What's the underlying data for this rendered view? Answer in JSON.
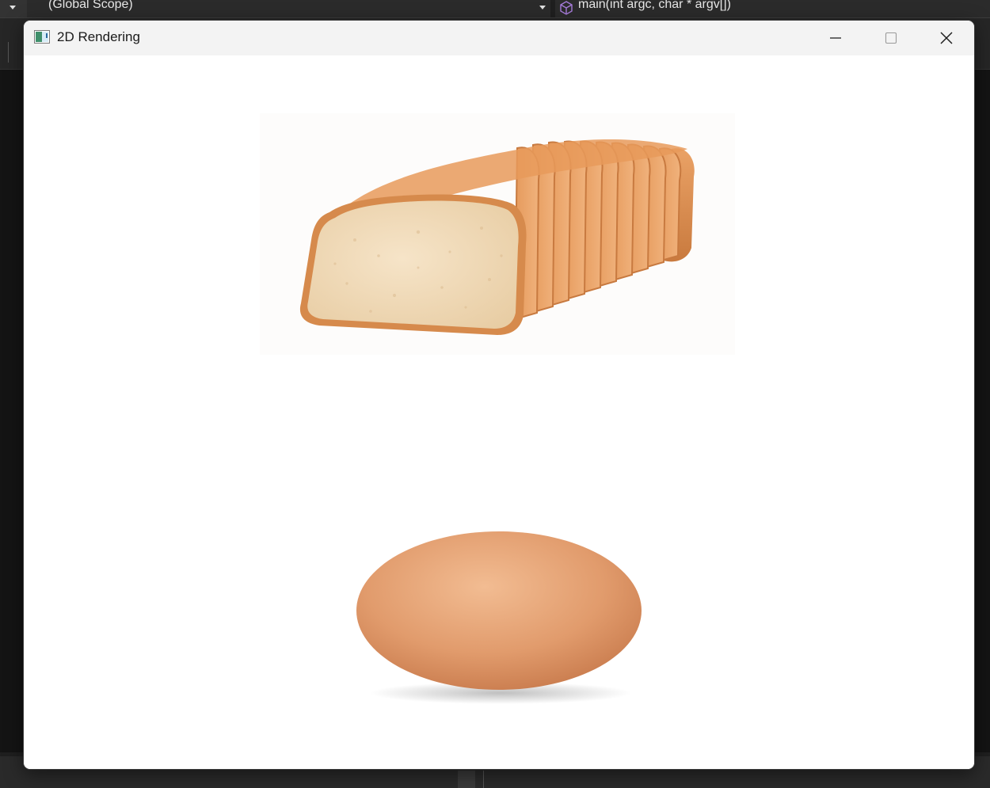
{
  "ide": {
    "scope_selector": "(Global Scope)",
    "function_selector": "main(int argc, char * argv[])"
  },
  "window": {
    "title": "2D Rendering",
    "icon": "app-window-icon",
    "controls": {
      "minimize_icon": "minimize-icon",
      "maximize_icon": "maximize-icon",
      "close_icon": "close-icon"
    }
  },
  "canvas": {
    "background": "#ffffff",
    "sprites": [
      {
        "name": "bread-loaf",
        "description_icon": "bread-image"
      },
      {
        "name": "egg",
        "description_icon": "egg-image"
      }
    ]
  },
  "colors": {
    "crust": "#d98a4e",
    "crumb": "#f1d9b5",
    "egg_shell": "#e3a173",
    "titlebar": "#f3f3f3"
  }
}
